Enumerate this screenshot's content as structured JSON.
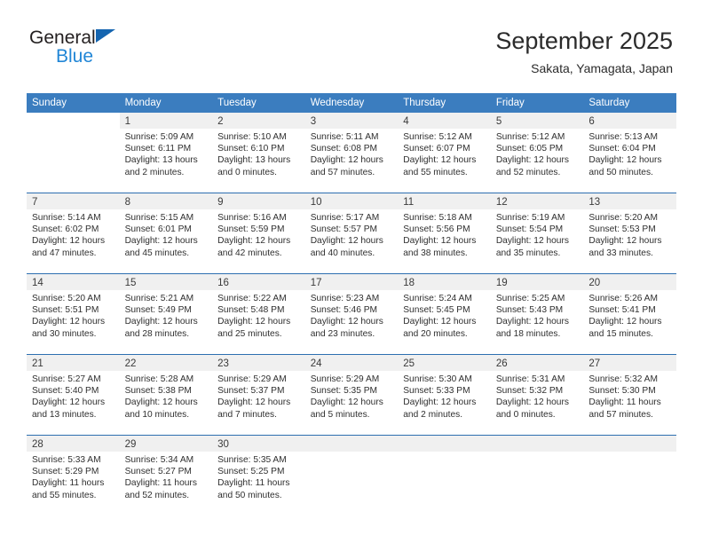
{
  "brand": {
    "line1": "General",
    "line2": "Blue",
    "triangle_color": "#1565b0",
    "blue_color": "#2186d6"
  },
  "header": {
    "title": "September 2025",
    "subtitle": "Sakata, Yamagata, Japan"
  },
  "colors": {
    "header_blue": "#3b7dbf",
    "row_divider": "#2d6fb0",
    "daynum_band": "#f0f0f0",
    "text": "#2f2f2f"
  },
  "weekday_headers": [
    "Sunday",
    "Monday",
    "Tuesday",
    "Wednesday",
    "Thursday",
    "Friday",
    "Saturday"
  ],
  "weeks": [
    [
      {
        "day": "",
        "sunrise": "",
        "sunset": "",
        "daylight_1": "",
        "daylight_2": "",
        "state": "blank"
      },
      {
        "day": "1",
        "sunrise": "Sunrise: 5:09 AM",
        "sunset": "Sunset: 6:11 PM",
        "daylight_1": "Daylight: 13 hours",
        "daylight_2": "and 2 minutes.",
        "state": "filled"
      },
      {
        "day": "2",
        "sunrise": "Sunrise: 5:10 AM",
        "sunset": "Sunset: 6:10 PM",
        "daylight_1": "Daylight: 13 hours",
        "daylight_2": "and 0 minutes.",
        "state": "filled"
      },
      {
        "day": "3",
        "sunrise": "Sunrise: 5:11 AM",
        "sunset": "Sunset: 6:08 PM",
        "daylight_1": "Daylight: 12 hours",
        "daylight_2": "and 57 minutes.",
        "state": "filled"
      },
      {
        "day": "4",
        "sunrise": "Sunrise: 5:12 AM",
        "sunset": "Sunset: 6:07 PM",
        "daylight_1": "Daylight: 12 hours",
        "daylight_2": "and 55 minutes.",
        "state": "filled"
      },
      {
        "day": "5",
        "sunrise": "Sunrise: 5:12 AM",
        "sunset": "Sunset: 6:05 PM",
        "daylight_1": "Daylight: 12 hours",
        "daylight_2": "and 52 minutes.",
        "state": "filled"
      },
      {
        "day": "6",
        "sunrise": "Sunrise: 5:13 AM",
        "sunset": "Sunset: 6:04 PM",
        "daylight_1": "Daylight: 12 hours",
        "daylight_2": "and 50 minutes.",
        "state": "filled"
      }
    ],
    [
      {
        "day": "7",
        "sunrise": "Sunrise: 5:14 AM",
        "sunset": "Sunset: 6:02 PM",
        "daylight_1": "Daylight: 12 hours",
        "daylight_2": "and 47 minutes.",
        "state": "filled"
      },
      {
        "day": "8",
        "sunrise": "Sunrise: 5:15 AM",
        "sunset": "Sunset: 6:01 PM",
        "daylight_1": "Daylight: 12 hours",
        "daylight_2": "and 45 minutes.",
        "state": "filled"
      },
      {
        "day": "9",
        "sunrise": "Sunrise: 5:16 AM",
        "sunset": "Sunset: 5:59 PM",
        "daylight_1": "Daylight: 12 hours",
        "daylight_2": "and 42 minutes.",
        "state": "filled"
      },
      {
        "day": "10",
        "sunrise": "Sunrise: 5:17 AM",
        "sunset": "Sunset: 5:57 PM",
        "daylight_1": "Daylight: 12 hours",
        "daylight_2": "and 40 minutes.",
        "state": "filled"
      },
      {
        "day": "11",
        "sunrise": "Sunrise: 5:18 AM",
        "sunset": "Sunset: 5:56 PM",
        "daylight_1": "Daylight: 12 hours",
        "daylight_2": "and 38 minutes.",
        "state": "filled"
      },
      {
        "day": "12",
        "sunrise": "Sunrise: 5:19 AM",
        "sunset": "Sunset: 5:54 PM",
        "daylight_1": "Daylight: 12 hours",
        "daylight_2": "and 35 minutes.",
        "state": "filled"
      },
      {
        "day": "13",
        "sunrise": "Sunrise: 5:20 AM",
        "sunset": "Sunset: 5:53 PM",
        "daylight_1": "Daylight: 12 hours",
        "daylight_2": "and 33 minutes.",
        "state": "filled"
      }
    ],
    [
      {
        "day": "14",
        "sunrise": "Sunrise: 5:20 AM",
        "sunset": "Sunset: 5:51 PM",
        "daylight_1": "Daylight: 12 hours",
        "daylight_2": "and 30 minutes.",
        "state": "filled"
      },
      {
        "day": "15",
        "sunrise": "Sunrise: 5:21 AM",
        "sunset": "Sunset: 5:49 PM",
        "daylight_1": "Daylight: 12 hours",
        "daylight_2": "and 28 minutes.",
        "state": "filled"
      },
      {
        "day": "16",
        "sunrise": "Sunrise: 5:22 AM",
        "sunset": "Sunset: 5:48 PM",
        "daylight_1": "Daylight: 12 hours",
        "daylight_2": "and 25 minutes.",
        "state": "filled"
      },
      {
        "day": "17",
        "sunrise": "Sunrise: 5:23 AM",
        "sunset": "Sunset: 5:46 PM",
        "daylight_1": "Daylight: 12 hours",
        "daylight_2": "and 23 minutes.",
        "state": "filled"
      },
      {
        "day": "18",
        "sunrise": "Sunrise: 5:24 AM",
        "sunset": "Sunset: 5:45 PM",
        "daylight_1": "Daylight: 12 hours",
        "daylight_2": "and 20 minutes.",
        "state": "filled"
      },
      {
        "day": "19",
        "sunrise": "Sunrise: 5:25 AM",
        "sunset": "Sunset: 5:43 PM",
        "daylight_1": "Daylight: 12 hours",
        "daylight_2": "and 18 minutes.",
        "state": "filled"
      },
      {
        "day": "20",
        "sunrise": "Sunrise: 5:26 AM",
        "sunset": "Sunset: 5:41 PM",
        "daylight_1": "Daylight: 12 hours",
        "daylight_2": "and 15 minutes.",
        "state": "filled"
      }
    ],
    [
      {
        "day": "21",
        "sunrise": "Sunrise: 5:27 AM",
        "sunset": "Sunset: 5:40 PM",
        "daylight_1": "Daylight: 12 hours",
        "daylight_2": "and 13 minutes.",
        "state": "filled"
      },
      {
        "day": "22",
        "sunrise": "Sunrise: 5:28 AM",
        "sunset": "Sunset: 5:38 PM",
        "daylight_1": "Daylight: 12 hours",
        "daylight_2": "and 10 minutes.",
        "state": "filled"
      },
      {
        "day": "23",
        "sunrise": "Sunrise: 5:29 AM",
        "sunset": "Sunset: 5:37 PM",
        "daylight_1": "Daylight: 12 hours",
        "daylight_2": "and 7 minutes.",
        "state": "filled"
      },
      {
        "day": "24",
        "sunrise": "Sunrise: 5:29 AM",
        "sunset": "Sunset: 5:35 PM",
        "daylight_1": "Daylight: 12 hours",
        "daylight_2": "and 5 minutes.",
        "state": "filled"
      },
      {
        "day": "25",
        "sunrise": "Sunrise: 5:30 AM",
        "sunset": "Sunset: 5:33 PM",
        "daylight_1": "Daylight: 12 hours",
        "daylight_2": "and 2 minutes.",
        "state": "filled"
      },
      {
        "day": "26",
        "sunrise": "Sunrise: 5:31 AM",
        "sunset": "Sunset: 5:32 PM",
        "daylight_1": "Daylight: 12 hours",
        "daylight_2": "and 0 minutes.",
        "state": "filled"
      },
      {
        "day": "27",
        "sunrise": "Sunrise: 5:32 AM",
        "sunset": "Sunset: 5:30 PM",
        "daylight_1": "Daylight: 11 hours",
        "daylight_2": "and 57 minutes.",
        "state": "filled"
      }
    ],
    [
      {
        "day": "28",
        "sunrise": "Sunrise: 5:33 AM",
        "sunset": "Sunset: 5:29 PM",
        "daylight_1": "Daylight: 11 hours",
        "daylight_2": "and 55 minutes.",
        "state": "filled"
      },
      {
        "day": "29",
        "sunrise": "Sunrise: 5:34 AM",
        "sunset": "Sunset: 5:27 PM",
        "daylight_1": "Daylight: 11 hours",
        "daylight_2": "and 52 minutes.",
        "state": "filled"
      },
      {
        "day": "30",
        "sunrise": "Sunrise: 5:35 AM",
        "sunset": "Sunset: 5:25 PM",
        "daylight_1": "Daylight: 11 hours",
        "daylight_2": "and 50 minutes.",
        "state": "filled"
      },
      {
        "day": "",
        "sunrise": "",
        "sunset": "",
        "daylight_1": "",
        "daylight_2": "",
        "state": "empty"
      },
      {
        "day": "",
        "sunrise": "",
        "sunset": "",
        "daylight_1": "",
        "daylight_2": "",
        "state": "empty"
      },
      {
        "day": "",
        "sunrise": "",
        "sunset": "",
        "daylight_1": "",
        "daylight_2": "",
        "state": "empty"
      },
      {
        "day": "",
        "sunrise": "",
        "sunset": "",
        "daylight_1": "",
        "daylight_2": "",
        "state": "empty"
      }
    ]
  ]
}
